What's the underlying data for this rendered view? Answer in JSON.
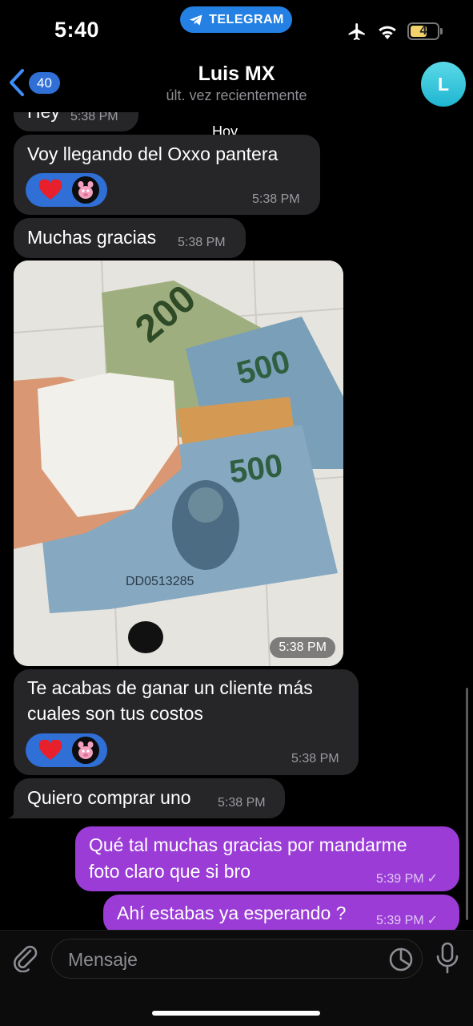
{
  "status_bar": {
    "time": "5:40",
    "app_pill": "TELEGRAM",
    "battery_level": "4",
    "accent": "#2481e3"
  },
  "header": {
    "back_count": "40",
    "title": "Luis MX",
    "subtitle": "últ. vez recientemente",
    "avatar_letter": "L"
  },
  "chat": {
    "date_chip": "Hoy",
    "messages": [
      {
        "dir": "in",
        "text": "Hey",
        "time": "5:38 PM"
      },
      {
        "dir": "in",
        "text": "Voy llegando del Oxxo pantera",
        "time": "5:38 PM",
        "reactions": [
          "heart-icon",
          "pink-panther-avatar"
        ]
      },
      {
        "dir": "in",
        "text": "Muchas gracias",
        "time": "5:38 PM"
      },
      {
        "dir": "in",
        "type": "photo",
        "time": "5:38 PM"
      },
      {
        "dir": "in",
        "text_line1": "Te acabas de ganar un cliente más",
        "text_line2": "cuales son tus costos",
        "time": "5:38 PM",
        "reactions": [
          "heart-icon",
          "pink-panther-avatar"
        ]
      },
      {
        "dir": "in",
        "text": "Quiero comprar uno",
        "time": "5:38 PM"
      },
      {
        "dir": "out",
        "text_line1": "Qué tal muchas gracias por mandarme",
        "text_line2": "foto claro que si bro",
        "time": "5:39 PM",
        "status": "✓"
      },
      {
        "dir": "out",
        "text": "Ahí estabas ya esperando ?",
        "time": "5:39 PM",
        "status": "✓"
      }
    ]
  },
  "input": {
    "placeholder": "Mensaje"
  },
  "colors": {
    "incoming_bubble": "#262628",
    "outgoing_bubble": "#9b3cd6",
    "reaction_pill": "#2f6fd6",
    "avatar": "#1fb6d1"
  }
}
